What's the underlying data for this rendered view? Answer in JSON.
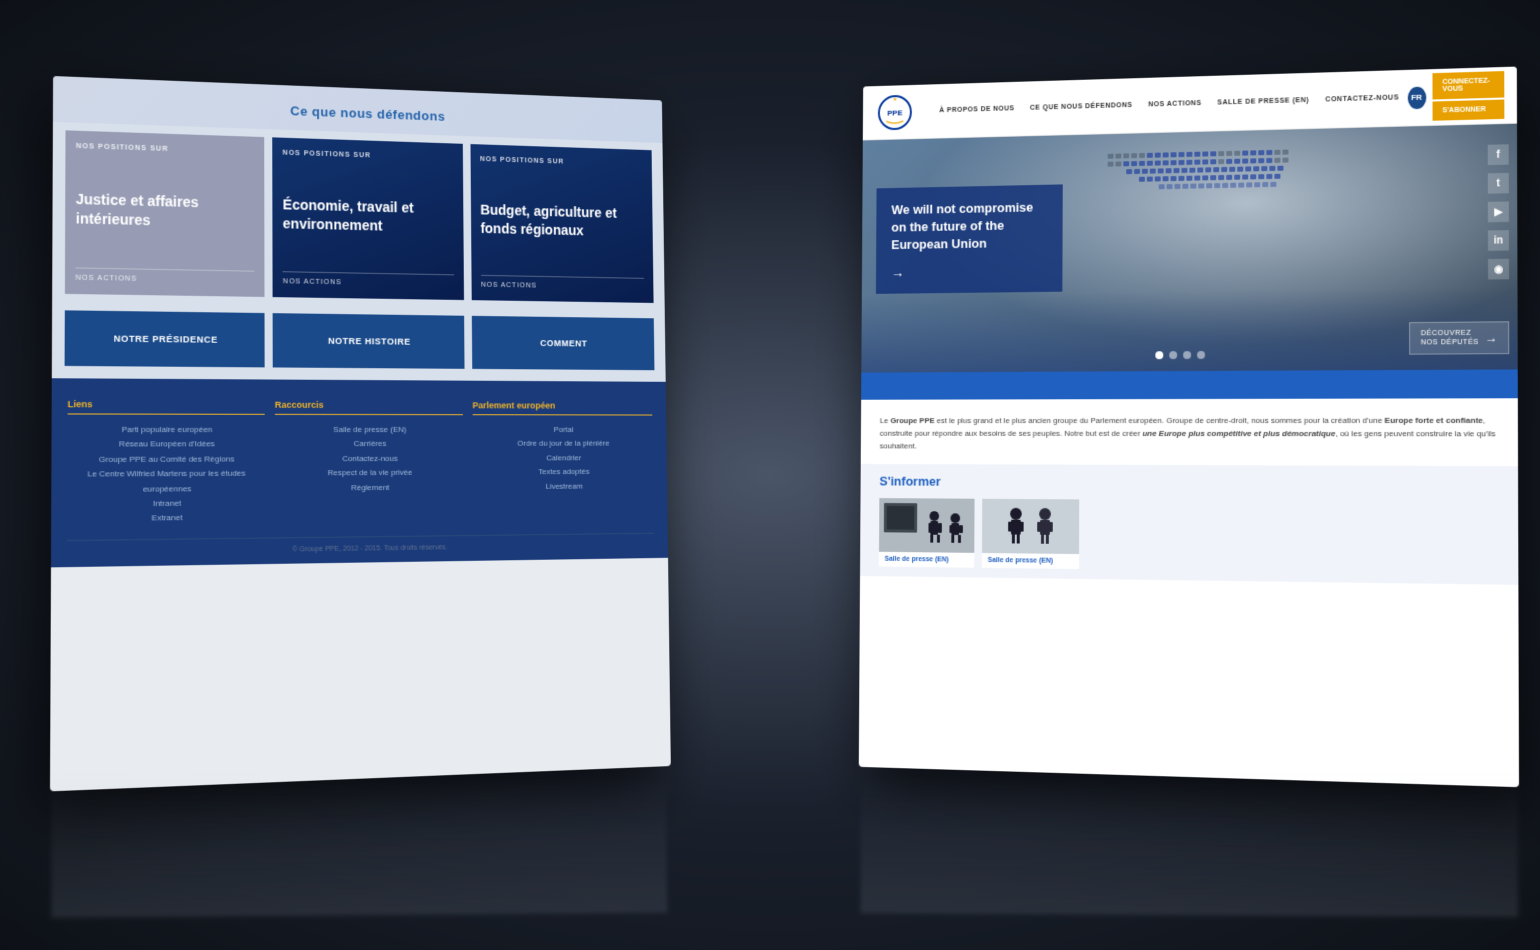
{
  "scene": {
    "background": "#1a202c"
  },
  "left_card": {
    "header": {
      "title": "Ce que nous défendons"
    },
    "positions": [
      {
        "label": "NOS POSITIONS SUR",
        "title": "Justice et affaires intérieures",
        "action": "NOS ACTIONS"
      },
      {
        "label": "NOS POSITIONS SUR",
        "title": "Économie, travail et environnement",
        "action": "NOS ACTIONS"
      },
      {
        "label": "NOS POSITIONS SUR",
        "title": "Budget, agriculture et fonds régionaux",
        "action": "NOS ACTIONS"
      }
    ],
    "actions": [
      {
        "label": "NOTRE PRÉSIDENCE"
      },
      {
        "label": "NOTRE HISTOIRE"
      },
      {
        "label": "COMMENT"
      }
    ],
    "footer": {
      "cols": [
        {
          "title": "Liens",
          "links": [
            "Parti populaire européen",
            "Réseau Européen d'Idées",
            "Groupe PPE au Comité des Régions",
            "Le Centre Wilfried Martens pour les études européennes",
            "Intranet",
            "Extranet"
          ]
        },
        {
          "title": "Raccourcis",
          "links": [
            "Salle de presse (EN)",
            "Carrières",
            "Contactez-nous",
            "Respect de la vie privée",
            "Règlement"
          ]
        },
        {
          "title": "Parlement européen",
          "links": [
            "Portal",
            "Ordre du jour de la plénière",
            "Calendrier",
            "Textes adoptés",
            "Livestream"
          ]
        }
      ],
      "copyright": "© Groupe PPE, 2012 - 2015. Tous droits réservés."
    }
  },
  "right_card": {
    "navbar": {
      "logo_text": "ppe",
      "logo_subtitle": "groupe du parlement européen",
      "links": [
        {
          "label": "À PROPOS DE NOUS"
        },
        {
          "label": "CE QUE NOUS DÉFENDONS"
        },
        {
          "label": "NOS ACTIONS"
        },
        {
          "label": "SALLE DE PRESSE (EN)"
        },
        {
          "label": "CONTACTEZ-NOUS"
        }
      ],
      "lang": "FR",
      "connect_label": "CONNECTEZ-VOUS",
      "subscribe_label": "S'ABONNER"
    },
    "hero": {
      "title": "We will not compromise on the future of the European Union",
      "arrow": "→",
      "dots": [
        {
          "active": true
        },
        {
          "active": false
        },
        {
          "active": false
        },
        {
          "active": false
        }
      ],
      "social": [
        "f",
        "t",
        "▶",
        "in",
        "◉"
      ],
      "deputies_line1": "DÉCOUVREZ",
      "deputies_line2": "NOS DÉPUTÉS"
    },
    "about": {
      "text_parts": [
        "Le ",
        "Groupe PPE",
        " est le plus grand et le plus ancien groupe du Parlement européen. Groupe de centre-droit, nous sommes pour la création d'une ",
        "Europe forte et confiante",
        ", construite pour répondre aux besoins de ses peuples. Notre but est de créer ",
        "une Europe plus compétitive et plus démocratique",
        ", où les gens peuvent construire la vie qu'ils souhaitent."
      ]
    },
    "sinformer": {
      "title": "S'informer",
      "cards": [
        {
          "label": "Salle de presse (EN)"
        }
      ]
    }
  }
}
